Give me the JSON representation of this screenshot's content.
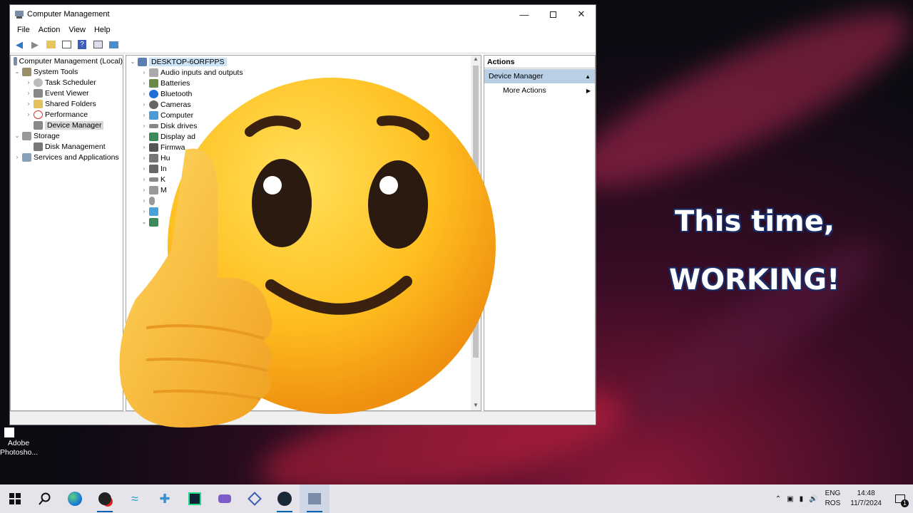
{
  "window": {
    "title": "Computer Management",
    "minimize_icon": "minimize-icon",
    "maximize_icon": "maximize-icon",
    "close_icon": "close-icon"
  },
  "menu": [
    "File",
    "Action",
    "View",
    "Help"
  ],
  "left_tree": {
    "root": "Computer Management (Local)",
    "system_tools": "System Tools",
    "task_scheduler": "Task Scheduler",
    "event_viewer": "Event Viewer",
    "shared_folders": "Shared Folders",
    "performance": "Performance",
    "device_manager": "Device Manager",
    "storage": "Storage",
    "disk_management": "Disk Management",
    "services": "Services and Applications"
  },
  "device_tree": {
    "host": "DESKTOP-6ORFPPS",
    "items": [
      "Audio inputs and outputs",
      "Batteries",
      "Bluetooth",
      "Cameras",
      "Computer",
      "Disk drives",
      "Display ad",
      "Firmwa",
      "Hu",
      "In",
      "K",
      "M"
    ]
  },
  "actions": {
    "header": "Actions",
    "section": "Device Manager",
    "item": "More Actions"
  },
  "overlay": {
    "line1": "This time,",
    "line2": "WORKING!"
  },
  "desktop": {
    "photoshop_label_1": "Adobe",
    "photoshop_label_2": "Photosho..."
  },
  "taskbar": {
    "lang_1": "ENG",
    "lang_2": "ROS",
    "time": "14:48",
    "date": "11/7/2024",
    "notification_count": "1"
  }
}
